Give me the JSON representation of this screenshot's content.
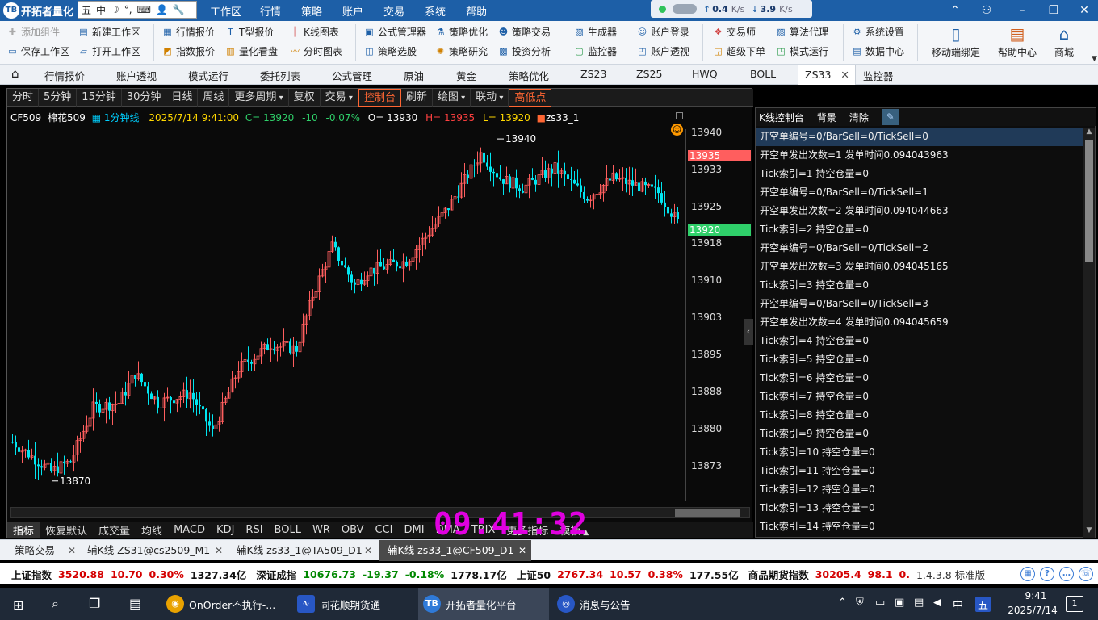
{
  "app": {
    "title": "开拓者量化",
    "logo": "TB"
  },
  "ime": {
    "items": [
      "五",
      "中",
      "☽",
      "°,",
      "⌨",
      "👤",
      "🔧"
    ]
  },
  "menu": [
    "工作区",
    "行情",
    "策略",
    "账户",
    "交易",
    "系统",
    "帮助"
  ],
  "net": {
    "up": "↑",
    "up_value": "0.4",
    "up_unit": "K/s",
    "down": "↓",
    "down_value": "3.9",
    "down_unit": "K/s"
  },
  "toolbar": {
    "r1": [
      {
        "label": "添加组件",
        "icon": "plus-gear-icon",
        "disabled": true
      },
      {
        "label": "新建工作区",
        "icon": "new-workspace-icon"
      },
      {
        "label": "行情报价",
        "icon": "quote-icon"
      },
      {
        "label": "T型报价",
        "icon": "t-quote-icon"
      },
      {
        "label": "K线图表",
        "icon": "kline-icon"
      },
      {
        "label": "公式管理器",
        "icon": "formula-icon"
      },
      {
        "label": "策略优化",
        "icon": "optimize-icon"
      },
      {
        "label": "策略交易",
        "icon": "strategy-trade-icon"
      },
      {
        "label": "生成器",
        "icon": "generator-icon"
      },
      {
        "label": "账户登录",
        "icon": "account-login-icon"
      },
      {
        "label": "交易师",
        "icon": "trader-icon"
      },
      {
        "label": "算法代理",
        "icon": "algo-icon"
      },
      {
        "label": "系统设置",
        "icon": "settings-icon"
      }
    ],
    "r2": [
      {
        "label": "保存工作区",
        "icon": "save-icon"
      },
      {
        "label": "打开工作区",
        "icon": "open-icon"
      },
      {
        "label": "指数报价",
        "icon": "index-quote-icon"
      },
      {
        "label": "量化看盘",
        "icon": "quant-view-icon"
      },
      {
        "label": "分时图表",
        "icon": "timeshare-icon"
      },
      {
        "label": "策略选股",
        "icon": "stock-pick-icon"
      },
      {
        "label": "策略研究",
        "icon": "research-icon"
      },
      {
        "label": "投资分析",
        "icon": "analysis-icon"
      },
      {
        "label": "监控器",
        "icon": "monitor-icon"
      },
      {
        "label": "账户透视",
        "icon": "account-view-icon"
      },
      {
        "label": "超级下单",
        "icon": "super-order-icon"
      },
      {
        "label": "模式运行",
        "icon": "mode-run-icon"
      },
      {
        "label": "数据中心",
        "icon": "data-center-icon"
      }
    ],
    "big": [
      {
        "label": "移动端绑定",
        "icon": "mobile-icon"
      },
      {
        "label": "帮助中心",
        "icon": "help-icon"
      },
      {
        "label": "商城",
        "icon": "shop-icon"
      }
    ]
  },
  "tabs": [
    "行情报价",
    "账户透视",
    "模式运行",
    "委托列表",
    "公式管理",
    "原油",
    "黄金",
    "策略优化",
    "ZS23",
    "ZS25",
    "HWQ",
    "BOLL",
    "ZS33",
    "监控器"
  ],
  "active_tab": "ZS33",
  "period_bar": [
    "分时",
    "5分钟",
    "15分钟",
    "30分钟",
    "日线",
    "周线",
    "更多周期",
    "复权",
    "交易",
    "控制台",
    "刷新",
    "绘图",
    "联动",
    "高低点"
  ],
  "infoline": {
    "symbol": "CF509",
    "name": "棉花509",
    "period": "1分钟线",
    "datetime": "2025/7/14 9:41:00",
    "c": "C= 13920",
    "chg": "-10",
    "pct": "-0.07%",
    "o": "O= 13930",
    "h": "H= 13935",
    "l": "L= 13920",
    "strategy": "zs33_1"
  },
  "chart": {
    "y_ticks": [
      "13940",
      "13933",
      "13925",
      "13918",
      "13910",
      "13903",
      "13895",
      "13888",
      "13880",
      "13873"
    ],
    "price_labels": [
      {
        "text": "13935",
        "color": "#ff5e5e"
      },
      {
        "text": "13920",
        "color": "#2fd06a"
      }
    ],
    "annotations": {
      "high": "13940",
      "low": "13870"
    }
  },
  "indicators": [
    "指标",
    "恢复默认",
    "成交量",
    "均线",
    "MACD",
    "KDJ",
    "RSI",
    "BOLL",
    "WR",
    "OBV",
    "CCI",
    "DMI",
    "DMA",
    "TRIX",
    "更多指标",
    "模板"
  ],
  "clock": "09:41:32",
  "panel": {
    "title": "K线控制台",
    "bg": "背景",
    "clear": "清除",
    "rows": [
      "开空单编号=0/BarSell=0/TickSell=0",
      "开空单发出次数=1  发单时间0.094043963",
      "Tick索引=1  持空仓量=0",
      "开空单编号=0/BarSell=0/TickSell=1",
      "开空单发出次数=2  发单时间0.094044663",
      "Tick索引=2  持空仓量=0",
      "开空单编号=0/BarSell=0/TickSell=2",
      "开空单发出次数=3  发单时间0.094045165",
      "Tick索引=3  持空仓量=0",
      "开空单编号=0/BarSell=0/TickSell=3",
      "开空单发出次数=4  发单时间0.094045659",
      "Tick索引=4  持空仓量=0",
      "Tick索引=5  持空仓量=0",
      "Tick索引=6  持空仓量=0",
      "Tick索引=7  持空仓量=0",
      "Tick索引=8  持空仓量=0",
      "Tick索引=9  持空仓量=0",
      "Tick索引=10  持空仓量=0",
      "Tick索引=11  持空仓量=0",
      "Tick索引=12  持空仓量=0",
      "Tick索引=13  持空仓量=0",
      "Tick索引=14  持空仓量=0"
    ]
  },
  "bottom_tabs": [
    "策略交易",
    "辅K线 ZS31@cs2509_M1",
    "辅K线 zs33_1@TA509_D1",
    "辅K线 zs33_1@CF509_D1"
  ],
  "ticker": {
    "items": [
      {
        "name": "上证指数",
        "price": "3520.88",
        "chg": "10.70",
        "pct": "0.30%",
        "amt": "1327.34亿",
        "dir": "up"
      },
      {
        "name": "深证成指",
        "price": "10676.73",
        "chg": "-19.37",
        "pct": "-0.18%",
        "amt": "1778.17亿",
        "dir": "down"
      },
      {
        "name": "上证50",
        "price": "2767.34",
        "chg": "10.57",
        "pct": "0.38%",
        "amt": "177.55亿",
        "dir": "up"
      },
      {
        "name": "商品期货指数",
        "price": "30205.4",
        "chg": "98.1",
        "pct": "0.",
        "amt": "",
        "dir": "up"
      }
    ],
    "version": "1.4.3.8 标准版"
  },
  "taskbar": {
    "apps": [
      {
        "label": "OnOrder不执行-...",
        "icon": "chrome-icon"
      },
      {
        "label": "同花顺期货通",
        "icon": "ths-icon"
      },
      {
        "label": "开拓者量化平台",
        "icon": "tb-icon"
      },
      {
        "label": "消息与公告",
        "icon": "message-icon"
      }
    ],
    "time": "9:41",
    "date": "2025/7/14",
    "ime_zh": "中",
    "ime_wubi": "五",
    "notif": "1"
  },
  "colors": {
    "up": "#ff5e5e",
    "down": "#00e5f0",
    "clock": "#e000e0",
    "active_period": "#ff6633"
  }
}
